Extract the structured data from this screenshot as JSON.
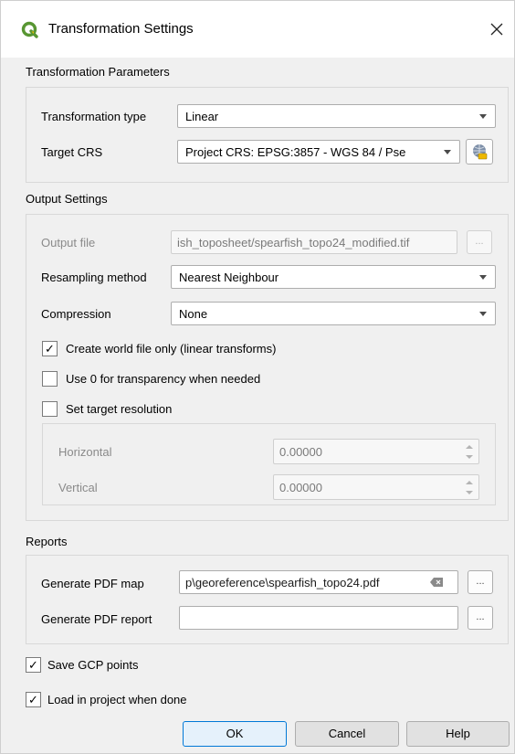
{
  "window": {
    "title": "Transformation Settings",
    "app_icon": "qgis-logo-icon",
    "close_icon": "close-icon"
  },
  "params": {
    "section_label": "Transformation Parameters",
    "type_label": "Transformation type",
    "type_value": "Linear",
    "crs_label": "Target CRS",
    "crs_value": "Project CRS: EPSG:3857 - WGS 84 / Pse",
    "crs_button_icon": "crs-selector-icon"
  },
  "output": {
    "section_label": "Output Settings",
    "file_label": "Output file",
    "file_value": "ish_toposheet/spearfish_topo24_modified.tif",
    "file_button": "...",
    "resampling_label": "Resampling method",
    "resampling_value": "Nearest Neighbour",
    "compression_label": "Compression",
    "compression_value": "None",
    "world_file_label": "Create world file only (linear transforms)",
    "world_file_checked": true,
    "transparency_label": "Use 0 for transparency when needed",
    "transparency_checked": false,
    "resolution_label": "Set target resolution",
    "resolution_checked": false,
    "horizontal_label": "Horizontal",
    "horizontal_value": "0.00000",
    "vertical_label": "Vertical",
    "vertical_value": "0.00000"
  },
  "reports": {
    "section_label": "Reports",
    "pdf_map_label": "Generate PDF map",
    "pdf_map_value": "p\\georeference\\spearfish_topo24.pdf",
    "pdf_map_button": "...",
    "pdf_report_label": "Generate PDF report",
    "pdf_report_value": "",
    "pdf_report_button": "..."
  },
  "options": {
    "save_gcp_label": "Save GCP points",
    "save_gcp_checked": true,
    "load_label": "Load in project when done",
    "load_checked": true
  },
  "buttons": {
    "ok": "OK",
    "cancel": "Cancel",
    "help": "Help"
  },
  "colors": {
    "accent": "#0078d7",
    "qgis_green": "#589632",
    "qgis_yellow": "#eeb902"
  },
  "check_glyph": "✓"
}
